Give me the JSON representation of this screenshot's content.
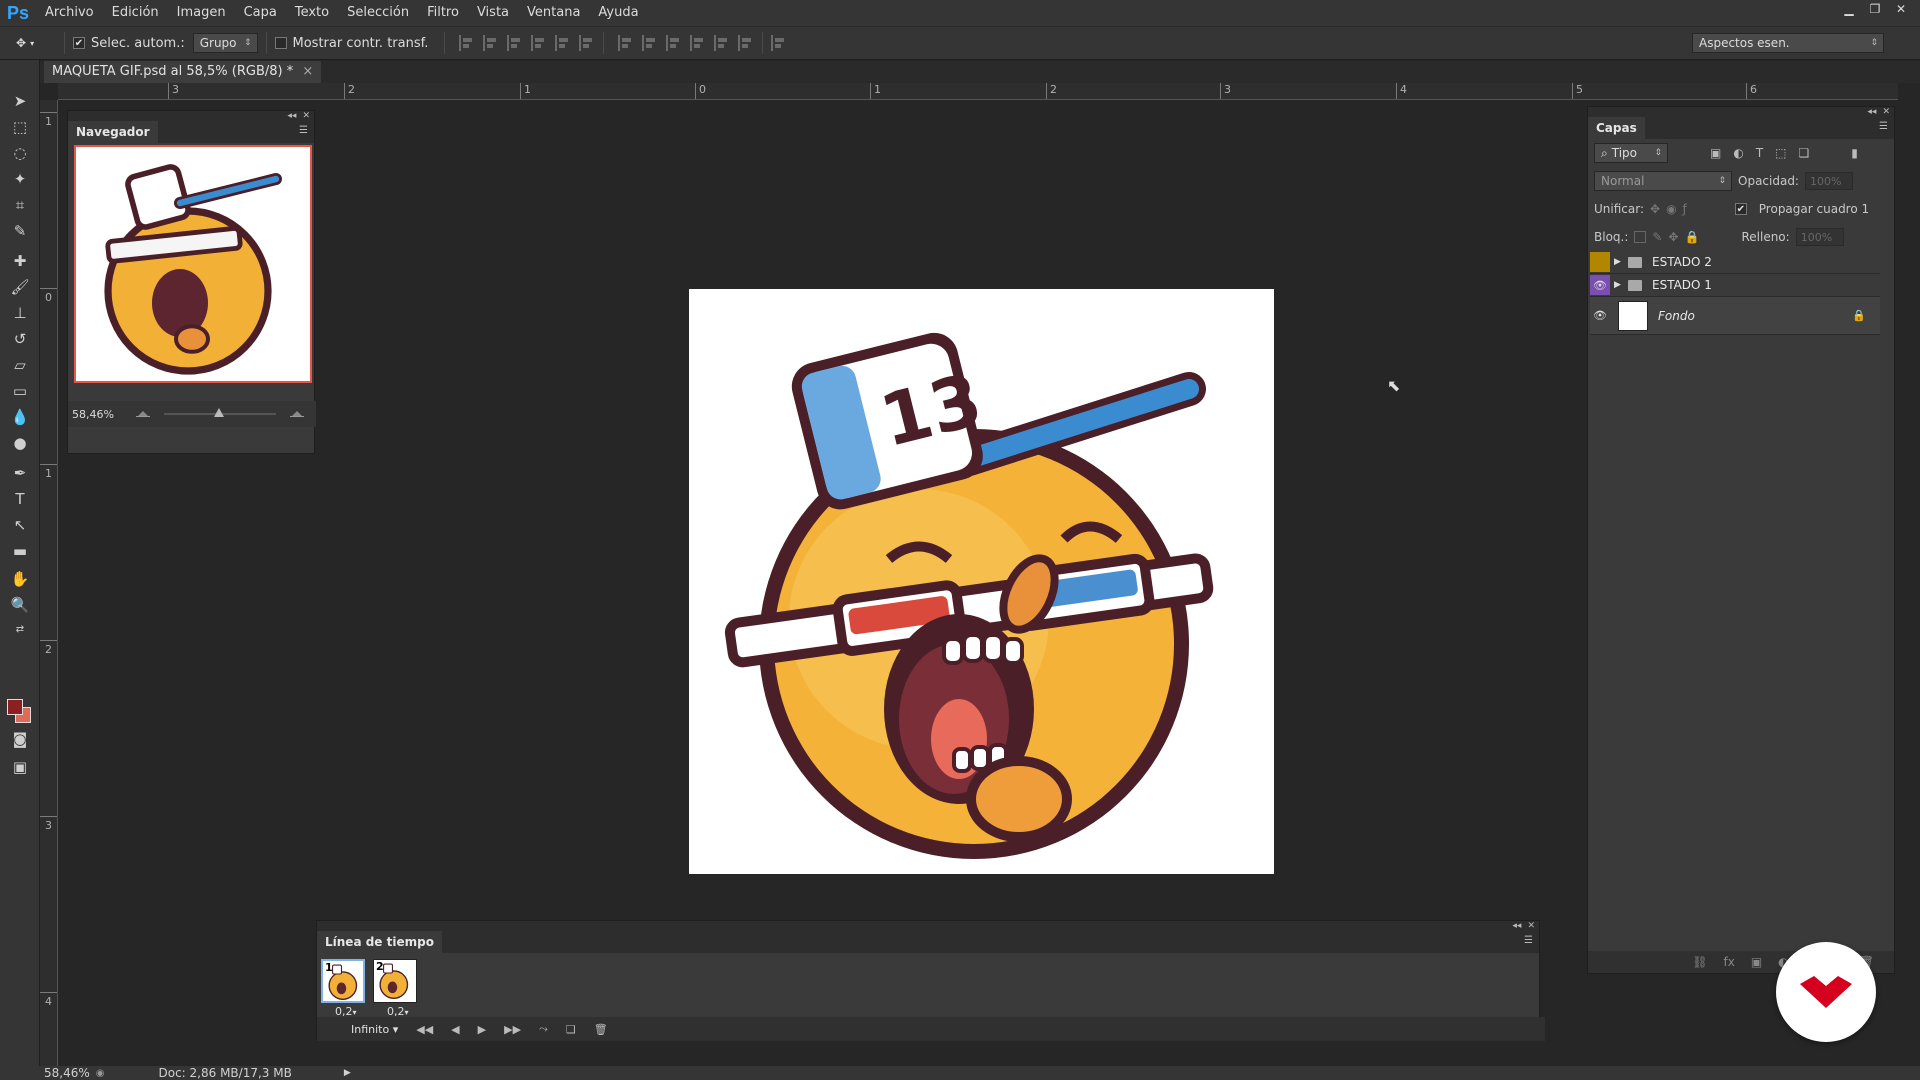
{
  "app": {
    "logo": "Ps"
  },
  "menu": [
    "Archivo",
    "Edición",
    "Imagen",
    "Capa",
    "Texto",
    "Selección",
    "Filtro",
    "Vista",
    "Ventana",
    "Ayuda"
  ],
  "options": {
    "auto_select_label": "Selec. autom.:",
    "auto_select_checked": true,
    "auto_select_value": "Grupo",
    "show_transform_label": "Mostrar contr. transf.",
    "show_transform_checked": false,
    "workspace": "Aspectos esen."
  },
  "document": {
    "tab_title": "MAQUETA GIF.psd al 58,5% (RGB/8) *",
    "close": "×"
  },
  "rulers": {
    "horizontal": [
      "3",
      "2",
      "1",
      "0",
      "1",
      "2",
      "3",
      "4",
      "5",
      "6"
    ],
    "vertical": [
      "1",
      "0",
      "1",
      "2",
      "3",
      "4"
    ]
  },
  "navigator": {
    "title": "Navegador",
    "zoom": "58,46%",
    "zoom_slider_fraction": 0.45
  },
  "layers": {
    "title": "Capas",
    "filter": "Tipo",
    "blend_mode": "Normal",
    "opacity_label": "Opacidad:",
    "opacity_value": "100%",
    "unify_label": "Unificar:",
    "propagate_label": "Propagar cuadro 1",
    "propagate_checked": true,
    "lock_label": "Bloq.:",
    "fill_label": "Relleno:",
    "fill_value": "100%",
    "items": [
      {
        "name": "ESTADO 2",
        "type": "group",
        "visible": false,
        "color": "#b38600"
      },
      {
        "name": "ESTADO 1",
        "type": "group",
        "visible": true,
        "color": "#7a4fb0"
      },
      {
        "name": "Fondo",
        "type": "background",
        "visible": true,
        "locked": true
      }
    ]
  },
  "timeline": {
    "title": "Línea de tiempo",
    "frames": [
      {
        "number": "1",
        "delay": "0,2",
        "selected": true
      },
      {
        "number": "2",
        "delay": "0,2",
        "selected": false
      }
    ],
    "loop": "Infinito"
  },
  "status": {
    "zoom": "58,46%",
    "doc": "Doc: 2,86 MB/17,3 MB"
  },
  "colors": {
    "foreground": "#8b2020",
    "background": "#e06a55",
    "accent": "#31a8ff",
    "brand_logo": "#d4001e"
  }
}
